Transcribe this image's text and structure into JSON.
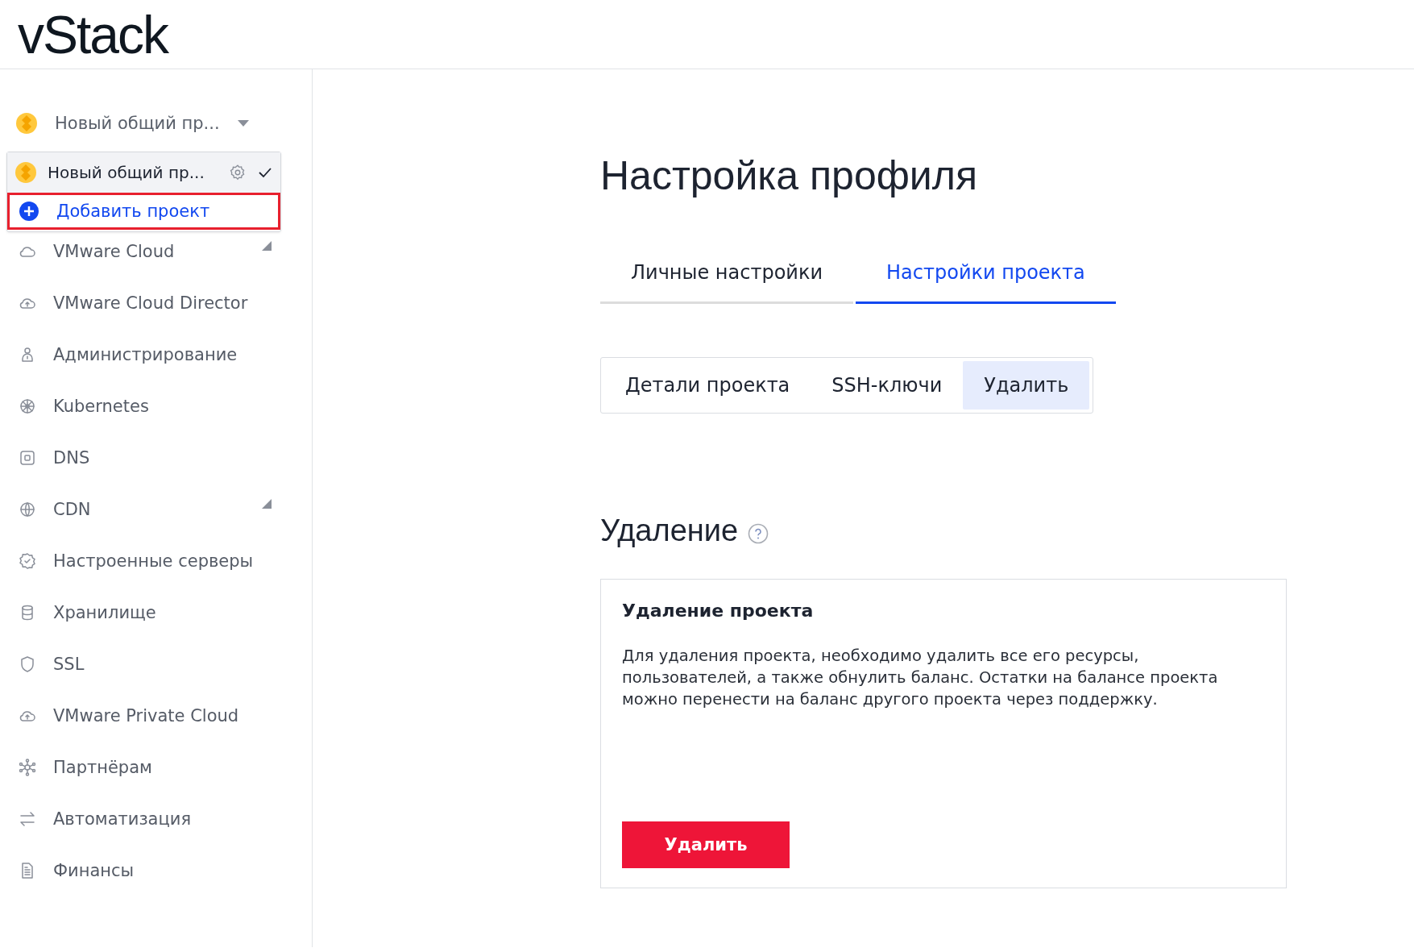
{
  "header": {
    "logo": "vStack"
  },
  "sidebar": {
    "project_switcher": {
      "label": "Новый общий пр..."
    },
    "project_menu": {
      "items": [
        {
          "kind": "project",
          "label": "Новый общий пр...",
          "selected": true
        },
        {
          "kind": "add",
          "label": "Добавить проект",
          "selected": false
        }
      ]
    },
    "items": [
      {
        "label": "VMware Cloud",
        "submenu": true
      },
      {
        "label": "VMware Cloud Director",
        "submenu": false
      },
      {
        "label": "Администрирование",
        "submenu": false
      },
      {
        "label": "Kubernetes",
        "submenu": false
      },
      {
        "label": "DNS",
        "submenu": false
      },
      {
        "label": "CDN",
        "submenu": true
      },
      {
        "label": "Настроенные серверы",
        "submenu": false
      },
      {
        "label": "Хранилище",
        "submenu": false
      },
      {
        "label": "SSL",
        "submenu": false
      },
      {
        "label": "VMware Private Cloud",
        "submenu": false
      },
      {
        "label": "Партнёрам",
        "submenu": false
      },
      {
        "label": "Автоматизация",
        "submenu": false
      },
      {
        "label": "Финансы",
        "submenu": false
      }
    ]
  },
  "main": {
    "title": "Настройка профиля",
    "tabs": [
      {
        "label": "Личные настройки",
        "selected": false
      },
      {
        "label": "Настройки проекта",
        "selected": true
      }
    ],
    "subtabs": [
      {
        "label": "Детали проекта",
        "selected": false
      },
      {
        "label": "SSH-ключи",
        "selected": false
      },
      {
        "label": "Удалить",
        "selected": true
      }
    ],
    "section_title": "Удаление",
    "card": {
      "title": "Удаление проекта",
      "text": "Для удаления проекта, необходимо удалить все его ресурсы, пользователей, а также обнулить баланс. Остатки на балансе проекта можно перенести на баланс другого проекта через поддержку.",
      "button": "Удалить"
    }
  }
}
